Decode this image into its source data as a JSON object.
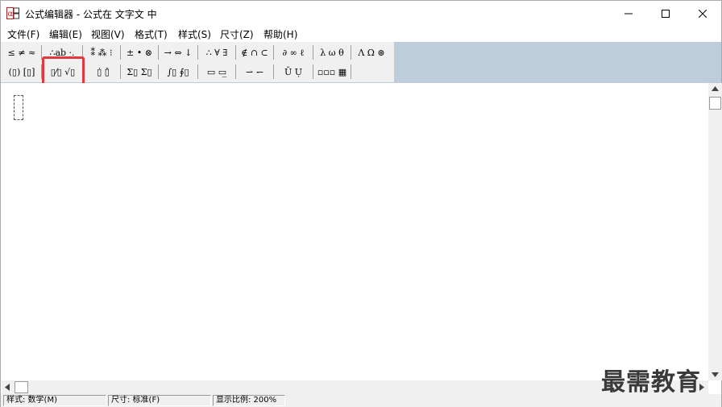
{
  "window": {
    "title": "公式编辑器 - 公式在 文字文 中",
    "controls": {
      "minimize": "—",
      "maximize": "☐",
      "close": "✕"
    }
  },
  "menu": [
    "文件(F)",
    "编辑(E)",
    "视图(V)",
    "格式(T)",
    "样式(S)",
    "尺寸(Z)",
    "帮助(H)"
  ],
  "toolbar": {
    "row1": [
      "≤ ≠ ≈",
      "∴ab ·.",
      "⁑ ⁂ ⁝",
      "± • ⊗",
      "→ ⇔ ↓",
      "∴ ∀ ∃",
      "∉ ∩ ⊂",
      "∂ ∞ ℓ",
      "λ ω θ",
      "Λ Ω ⊛"
    ],
    "row2": [
      "(▯) [▯]",
      "▯⁄▯ √▯",
      "▯̇ ▯̂",
      "Σ▯ Σ▯",
      "∫▯ ∮▯",
      "▭ ▭̲",
      "⇀ ↽",
      "Ū Ụ",
      "▫▫▫ ▦"
    ]
  },
  "status": {
    "style": "样式: 数学(M)",
    "size": "尺寸: 标准(F)",
    "zoom": "显示比例: 200%"
  },
  "watermark": "最需教育"
}
